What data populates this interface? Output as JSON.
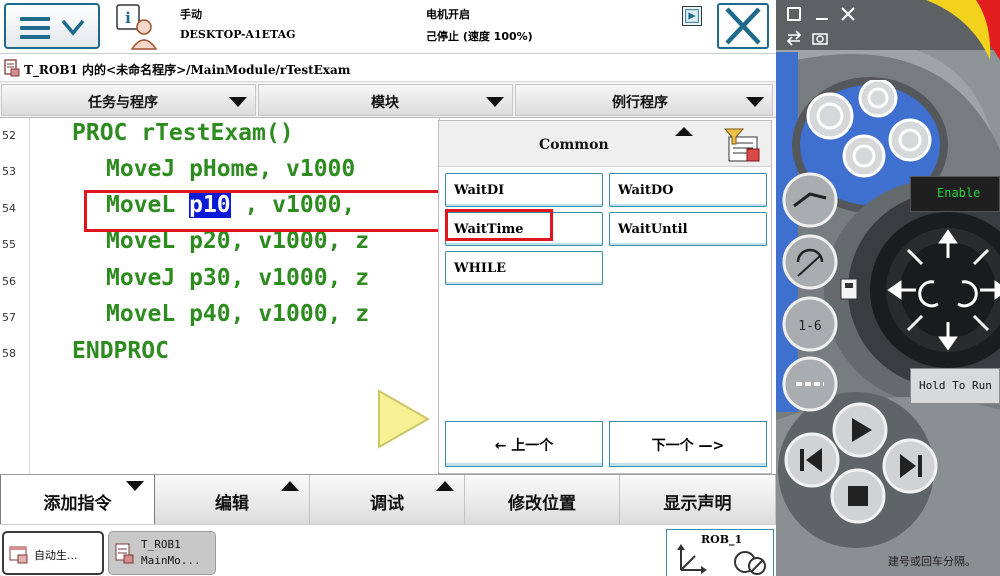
{
  "topbar": {
    "status": {
      "mode": "手动",
      "host": "DESKTOP-A1ETAG",
      "motor": "电机开启",
      "state": "己停止 (速度 100%)"
    }
  },
  "breadcrumb": {
    "text": "T_ROB1 内的<未命名程序>/MainModule/rTestExam"
  },
  "menu_tabs": [
    {
      "label": "任务与程序"
    },
    {
      "label": "模块"
    },
    {
      "label": "例行程序"
    }
  ],
  "editor": {
    "lines": [
      {
        "num": "52",
        "text": "PROC rTestExam()"
      },
      {
        "num": "53",
        "text": "MoveJ pHome, v1000"
      },
      {
        "num": "54",
        "before": "MoveL ",
        "highlight": "p10",
        "after": " , v1000,"
      },
      {
        "num": "55",
        "text": "MoveL p20, v1000, z"
      },
      {
        "num": "56",
        "text": "MoveJ p30, v1000, z"
      },
      {
        "num": "57",
        "text": "MoveL p40, v1000, z"
      },
      {
        "num": "58",
        "text": "ENDPROC"
      }
    ]
  },
  "picker": {
    "title": "Common",
    "items": [
      {
        "label": "WaitDI"
      },
      {
        "label": "WaitDO"
      },
      {
        "label": "WaitTime"
      },
      {
        "label": "WaitUntil"
      },
      {
        "label": "WHILE"
      }
    ],
    "prev_label": "←  上一个",
    "next_label": "下一个 —>"
  },
  "bottom_tabs": [
    {
      "label": "添加指令"
    },
    {
      "label": "编辑"
    },
    {
      "label": "调试"
    },
    {
      "label": "修改位置"
    },
    {
      "label": "显示声明"
    }
  ],
  "taskbar": {
    "task1": "自动生...",
    "task2_line1": "T_ROB1",
    "task2_line2": "MainMo...",
    "rob_label": "ROB_1"
  },
  "controller": {
    "enable_label": "Enable",
    "hold_label": "Hold To Run",
    "footnote": "建号或回车分隔。"
  },
  "colors": {
    "code_green": "#2e8b1f",
    "highlight_blue": "#0a1ad6",
    "annotation_red": "#e0161e",
    "frame_teal": "#1d6a8c"
  }
}
